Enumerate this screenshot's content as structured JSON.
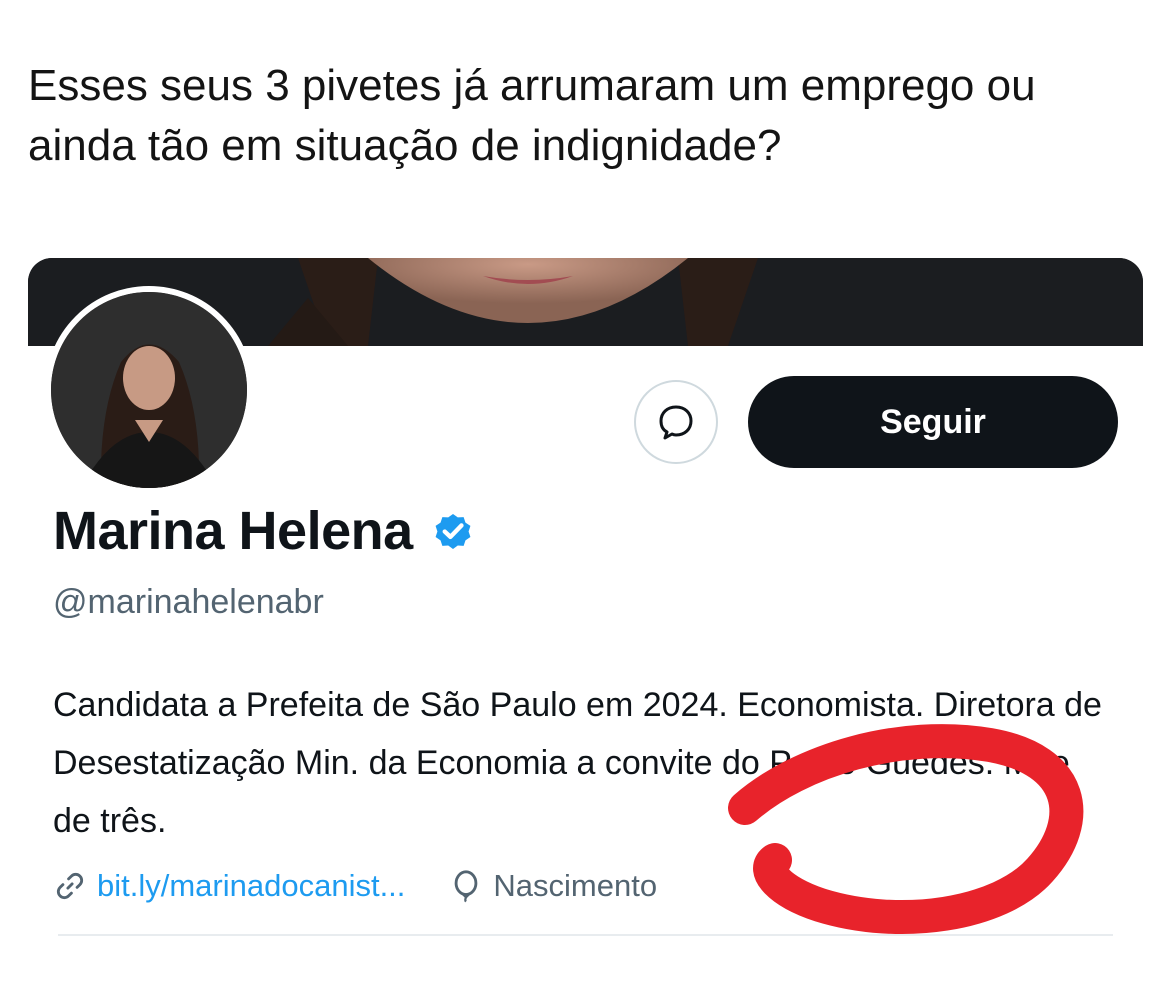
{
  "post": {
    "caption": "Esses seus 3 pivetes já arrumaram um emprego ou ainda tão em situação de indignidade?"
  },
  "profile": {
    "name": "Marina Helena",
    "handle": "@marinahelenabr",
    "bio": "Candidata a Prefeita de São Paulo em 2024. Economista. Diretora de Desestatização Min. da Economia a convite do Paulo Guedes. Mãe de três.",
    "link": "bit.ly/marinadocanist...",
    "birthday": "Nascimento",
    "follow_label": "Seguir"
  },
  "icons": {
    "message": "message-bubble-icon",
    "verified": "verified-badge-icon",
    "link": "link-icon",
    "birthday": "balloon-icon"
  },
  "colors": {
    "follow_button": "#0f1419",
    "verified": "#1d9bf0",
    "link": "#1d9bf0",
    "annotation": "#e8232b"
  }
}
